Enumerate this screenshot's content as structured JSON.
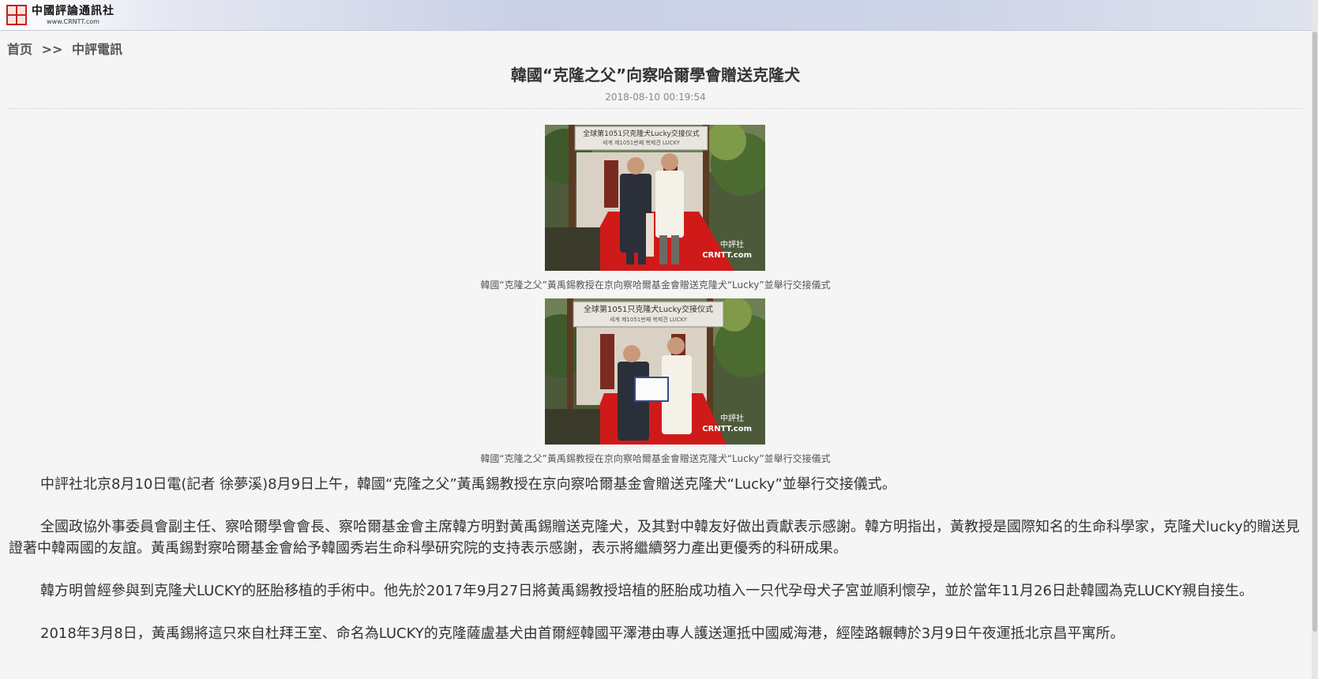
{
  "header": {
    "logo_cn": "中國評論通訊社",
    "logo_url": "www.CRNTT.com"
  },
  "breadcrumb": {
    "home": "首页",
    "separator": ">>",
    "section": "中評電訊"
  },
  "article": {
    "title": "韓國“克隆之父”向察哈爾學會贈送克隆犬",
    "datetime": "2018-08-10 00:19:54",
    "photos": [
      {
        "banner_text": "全球第1051只克隆犬Lucky交接仪式",
        "banner_sub": "세계 제1051번째 복제견 LUCKY",
        "watermark_cn": "中評社",
        "watermark_en": "CRNTT.com",
        "caption": "韓國“克隆之父”黃禹錫教授在京向察哈爾基金會贈送克隆犬“Lucky”並舉行交接儀式"
      },
      {
        "banner_text": "全球第1051只克隆犬Lucky交接仪式",
        "banner_sub": "세계 제1051번째 복제견 LUCKY",
        "watermark_cn": "中評社",
        "watermark_en": "CRNTT.com",
        "caption": "韓國“克隆之父”黃禹錫教授在京向察哈爾基金會贈送克隆犬“Lucky”並舉行交接儀式"
      }
    ],
    "paragraphs": [
      "中評社北京8月10日電(記者 徐夢溪)8月9日上午，韓國“克隆之父”黃禹錫教授在京向察哈爾基金會贈送克隆犬“Lucky”並舉行交接儀式。",
      "全國政協外事委員會副主任、察哈爾學會會長、察哈爾基金會主席韓方明對黃禹錫贈送克隆犬，及其對中韓友好做出貢獻表示感謝。韓方明指出，黃教授是國際知名的生命科學家，克隆犬lucky的贈送見證著中韓兩國的友誼。黃禹錫對察哈爾基金會給予韓國秀岩生命科學研究院的支持表示感謝，表示將繼續努力產出更優秀的科研成果。",
      "韓方明曾經參與到克隆犬LUCKY的胚胎移植的手術中。他先於2017年9月27日將黃禹錫教授培植的胚胎成功植入一只代孕母犬子宮並順利懷孕，並於當年11月26日赴韓國為克LUCKY親自接生。",
      "2018年3月8日，黃禹錫將這只來自杜拜王室、命名為LUCKY的克隆薩盧基犬由首爾經韓國平澤港由專人護送運抵中國威海港，經陸路輾轉於3月9日午夜運抵北京昌平寓所。"
    ]
  }
}
